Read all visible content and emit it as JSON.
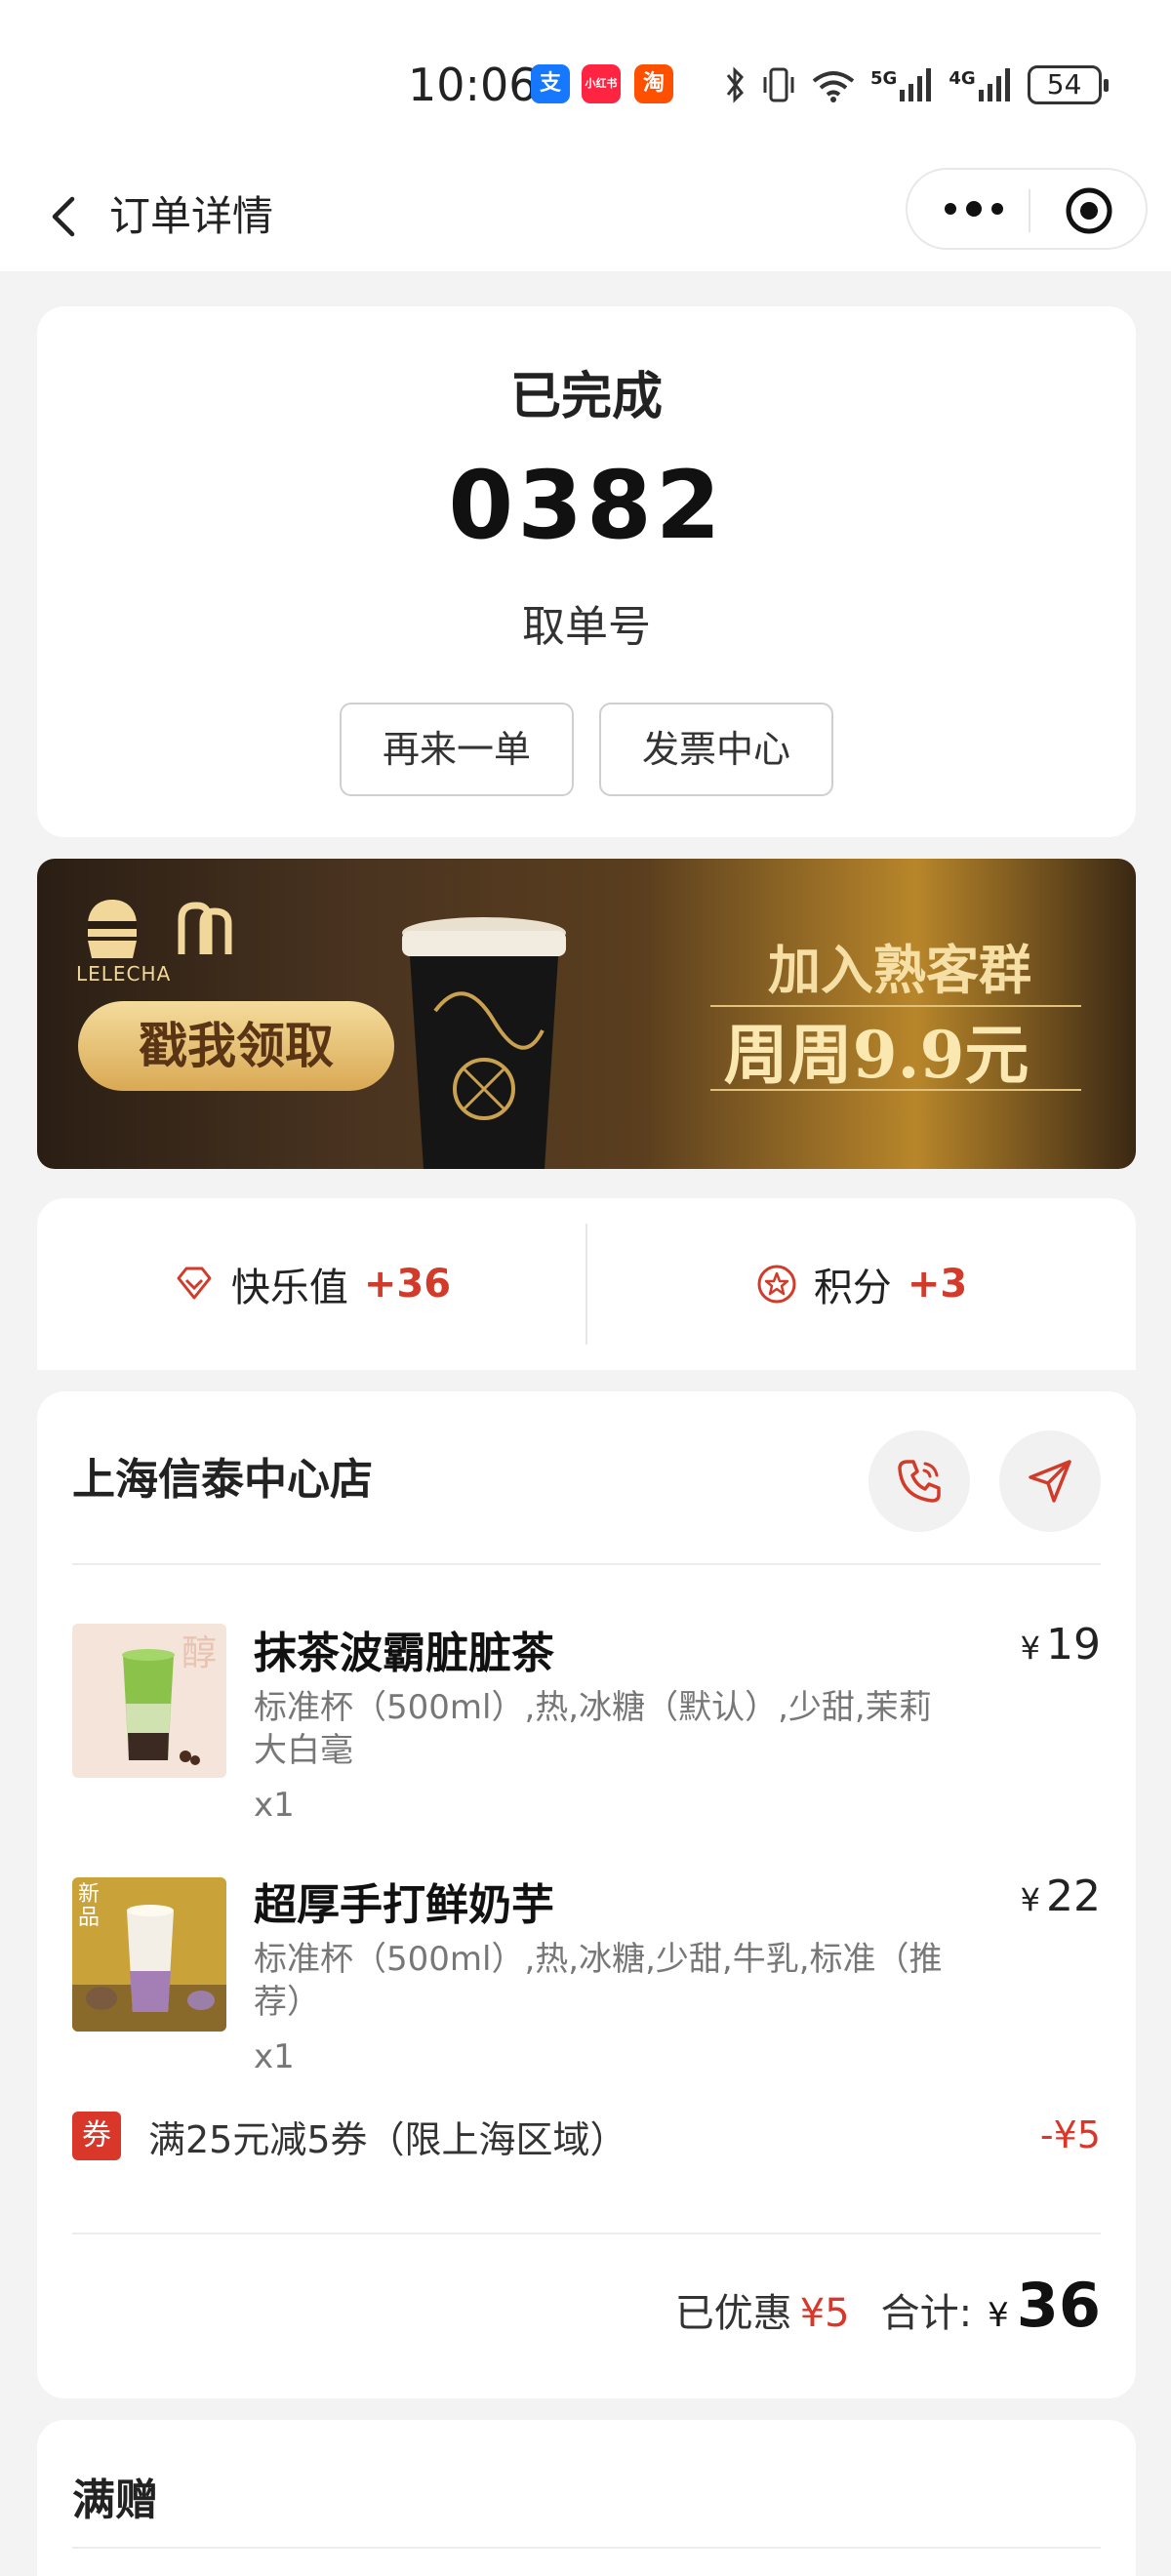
{
  "status_bar": {
    "time": "10:06",
    "apps": [
      {
        "name": "alipay-icon",
        "glyph": "支",
        "color": "#1677ff"
      },
      {
        "name": "xiaohongshu-icon",
        "glyph": "小红书",
        "color": "#ff2442"
      },
      {
        "name": "taobao-icon",
        "glyph": "淘",
        "color": "#ff5000"
      }
    ],
    "network": [
      "5G",
      "4G"
    ],
    "battery": "54"
  },
  "nav": {
    "title": "订单详情"
  },
  "order_status": {
    "status": "已完成",
    "pickup_number": "0382",
    "pickup_label": "取单号",
    "reorder_label": "再来一单",
    "invoice_label": "发票中心"
  },
  "banner": {
    "brand": "LELECHA",
    "cta": "戳我领取",
    "headline": "加入熟客群",
    "promo": "周周9.9元"
  },
  "points": {
    "happiness_label": "快乐值",
    "happiness_value": "+36",
    "score_label": "积分",
    "score_value": "+3"
  },
  "order": {
    "store_name": "上海信泰中心店",
    "items": [
      {
        "name": "抹茶波霸脏脏茶",
        "desc": "标准杯（500ml）,热,冰糖（默认）,少甜,茉莉大白毫",
        "qty": "x1",
        "price": "19"
      },
      {
        "name": "超厚手打鲜奶芋",
        "desc": "标准杯（500ml）,热,冰糖,少甜,牛乳,标准（推荐）",
        "qty": "x1",
        "price": "22",
        "badge": "新品"
      }
    ],
    "coupon_tag": "券",
    "coupon_text": "满25元减5券（限上海区域）",
    "coupon_amount": "-¥5",
    "saved_label": "已优惠",
    "saved_value": "¥5",
    "total_label": "合计:",
    "currency": "¥",
    "total_value": "36"
  },
  "gift": {
    "title": "满赠"
  },
  "colors": {
    "accent_red": "#d8372a",
    "background": "#f3f3f3"
  }
}
